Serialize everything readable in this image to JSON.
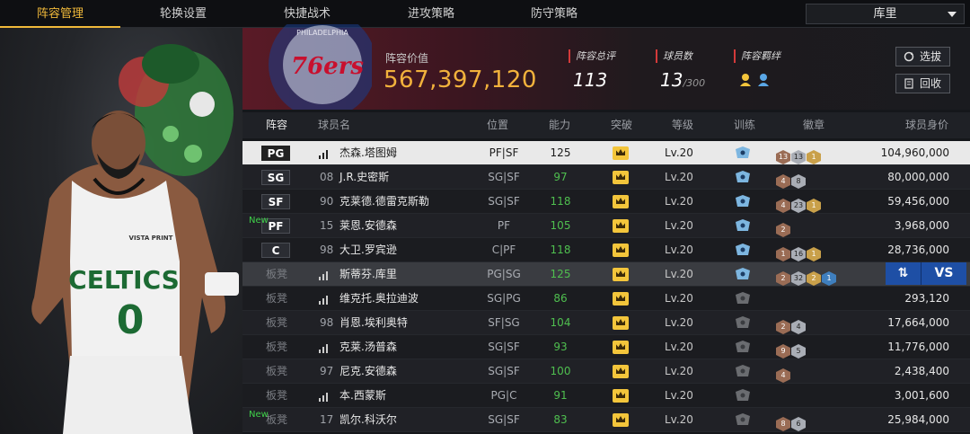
{
  "tabs": [
    "阵容管理",
    "轮换设置",
    "快捷战术",
    "进攻策略",
    "防守策略"
  ],
  "active_tab": 0,
  "team_select": "库里",
  "header": {
    "value_label": "阵容价值",
    "value": "567,397,120",
    "rating_label": "阵容总评",
    "rating": "113",
    "players_label": "球员数",
    "players": "13",
    "players_max": "/300",
    "bond_label": "阵容羁绊",
    "buttons": [
      "选拔",
      "回收"
    ],
    "team_logo_text": "76ers",
    "team_logo_ring": "PHILADELPHIA"
  },
  "columns": [
    "阵容",
    "球员名",
    "位置",
    "能力",
    "突破",
    "等级",
    "训练",
    "徽章",
    "球员身价"
  ],
  "rows": [
    {
      "slot": "PG",
      "new": "",
      "num": "",
      "name": "杰森.塔图姆",
      "pos": "PF|SF",
      "ability": "125",
      "level": "Lv.20",
      "badges": [
        "13",
        "13",
        "1"
      ],
      "salary": "104,960,000",
      "highlight": true
    },
    {
      "slot": "SG",
      "new": "",
      "num": "08",
      "name": "J.R.史密斯",
      "pos": "SG|SF",
      "ability": "97",
      "level": "Lv.20",
      "badges": [
        "4",
        "8"
      ],
      "salary": "80,000,000"
    },
    {
      "slot": "SF",
      "new": "",
      "num": "90",
      "name": "克莱德.德雷克斯勒",
      "pos": "SG|SF",
      "ability": "118",
      "level": "Lv.20",
      "badges": [
        "4",
        "23",
        "1"
      ],
      "salary": "59,456,000"
    },
    {
      "slot": "PF",
      "new": "New",
      "num": "15",
      "name": "莱恩.安德森",
      "pos": "PF",
      "ability": "105",
      "level": "Lv.20",
      "badges": [
        "2"
      ],
      "salary": "3,968,000"
    },
    {
      "slot": "C",
      "new": "",
      "num": "98",
      "name": "大卫.罗宾逊",
      "pos": "C|PF",
      "ability": "118",
      "level": "Lv.20",
      "badges": [
        "1",
        "16",
        "1"
      ],
      "salary": "28,736,000"
    },
    {
      "slot": "板凳",
      "new": "",
      "num": "",
      "name": "斯蒂芬.库里",
      "pos": "PG|SG",
      "ability": "125",
      "level": "Lv.20",
      "badges": [
        "2",
        "32",
        "2",
        "1"
      ],
      "salary": "",
      "bench_hl": true
    },
    {
      "slot": "板凳",
      "new": "",
      "num": "",
      "name": "维克托.奥拉迪波",
      "pos": "SG|PG",
      "ability": "86",
      "level": "Lv.20",
      "badges": [],
      "salary": "293,120"
    },
    {
      "slot": "板凳",
      "new": "",
      "num": "98",
      "name": "肖恩.埃利奥特",
      "pos": "SF|SG",
      "ability": "104",
      "level": "Lv.20",
      "badges": [
        "2",
        "4"
      ],
      "salary": "17,664,000"
    },
    {
      "slot": "板凳",
      "new": "",
      "num": "",
      "name": "克莱.汤普森",
      "pos": "SG|SF",
      "ability": "93",
      "level": "Lv.20",
      "badges": [
        "9",
        "5"
      ],
      "salary": "11,776,000"
    },
    {
      "slot": "板凳",
      "new": "",
      "num": "97",
      "name": "尼克.安德森",
      "pos": "SG|SF",
      "ability": "100",
      "level": "Lv.20",
      "badges": [
        "4"
      ],
      "salary": "2,438,400"
    },
    {
      "slot": "板凳",
      "new": "",
      "num": "",
      "name": "本.西蒙斯",
      "pos": "PG|C",
      "ability": "91",
      "level": "Lv.20",
      "badges": [],
      "salary": "3,001,600"
    },
    {
      "slot": "板凳",
      "new": "New",
      "num": "17",
      "name": "凯尔.科沃尔",
      "pos": "SG|SF",
      "ability": "83",
      "level": "Lv.20",
      "badges": [
        "8",
        "6"
      ],
      "salary": "25,984,000"
    }
  ],
  "swap_button": {
    "icon": "swap-arrows-icon",
    "label": "VS"
  },
  "art": {
    "jersey_text": "CELTICS",
    "jersey_number": "0",
    "sponsor_text": "VISTA PRINT"
  },
  "colors": {
    "accent": "#f0b93a",
    "ability_green": "#4fbf4f",
    "value_gold": "#f2b23c",
    "swap_blue": "#1e4fa5"
  }
}
